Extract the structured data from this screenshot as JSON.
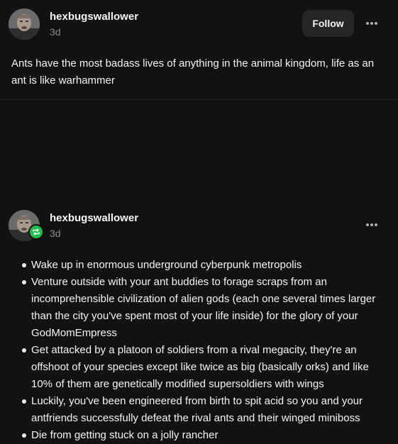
{
  "post1": {
    "username": "hexbugswallower",
    "time": "3d",
    "follow_label": "Follow",
    "text": "Ants have the most badass lives of anything in the animal kingdom, life as an ant is like warhammer"
  },
  "post2": {
    "username": "hexbugswallower",
    "time": "3d",
    "bullets": [
      "Wake up in enormous underground cyberpunk metropolis",
      "Venture outside with your ant buddies to forage scraps from an incomprehensible civilization of alien gods (each one several times larger than the city you've spent most of your life inside) for the glory of your GodMomEmpress",
      "Get attacked by a platoon of soldiers from a rival megacity, they're an offshoot of your species except like twice as big (basically orks) and like 10% of them are genetically modified supersoldiers with wings",
      "Luckily, you've been engineered from birth to spit acid so you and your antfriends successfully defeat the rival ants and their winged miniboss",
      "Die from getting stuck on a jolly rancher"
    ]
  },
  "colors": {
    "background": "#121212",
    "text": "#f3f5f7",
    "muted": "#8a8a8a",
    "button_bg": "#262626",
    "repost_badge": "#1fbf4a"
  },
  "icons": {
    "more": "more-horizontal-icon",
    "repost": "repost-icon",
    "avatar": "avatar"
  }
}
